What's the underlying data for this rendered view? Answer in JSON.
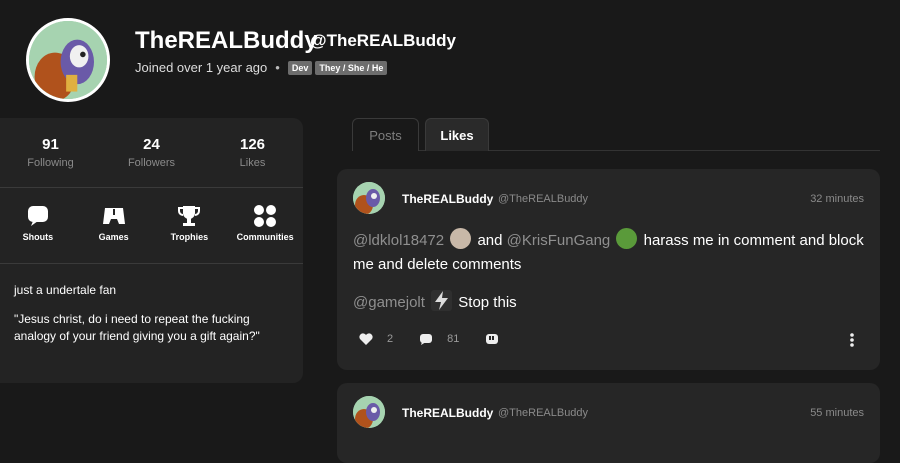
{
  "profile": {
    "display_name": "TheREALBuddy",
    "handle": "@TheREALBuddy",
    "joined": "Joined over 1 year ago",
    "tags": [
      "Dev",
      "They / She / He"
    ]
  },
  "stats": [
    {
      "value": "91",
      "label": "Following"
    },
    {
      "value": "24",
      "label": "Followers"
    },
    {
      "value": "126",
      "label": "Likes"
    }
  ],
  "links": [
    {
      "label": "Shouts",
      "icon": "chat-bubble-icon"
    },
    {
      "label": "Games",
      "icon": "gamepad-icon"
    },
    {
      "label": "Trophies",
      "icon": "trophy-icon"
    },
    {
      "label": "Communities",
      "icon": "grid-dots-icon"
    }
  ],
  "bio": {
    "line1": "just a undertale fan",
    "line2": "\"Jesus christ, do i need to repeat the fucking analogy of your friend giving you a gift again?\""
  },
  "tabs": {
    "posts": "Posts",
    "likes": "Likes"
  },
  "posts": [
    {
      "name": "TheREALBuddy",
      "handle": "@TheREALBuddy",
      "time": "32 minutes",
      "mention1": "@ldklol18472",
      "text1": "and",
      "mention2": "@KrisFunGang",
      "text2": "harass me in comment and block me and delete comments",
      "mention3": "@gamejolt",
      "text3": "Stop this",
      "likes": "2",
      "comments": "81"
    },
    {
      "name": "TheREALBuddy",
      "handle": "@TheREALBuddy",
      "time": "55 minutes"
    }
  ],
  "colors": {
    "background": "#191919",
    "card": "#262626",
    "muted": "#8a8a8a",
    "tag": "#6d6d6d"
  }
}
